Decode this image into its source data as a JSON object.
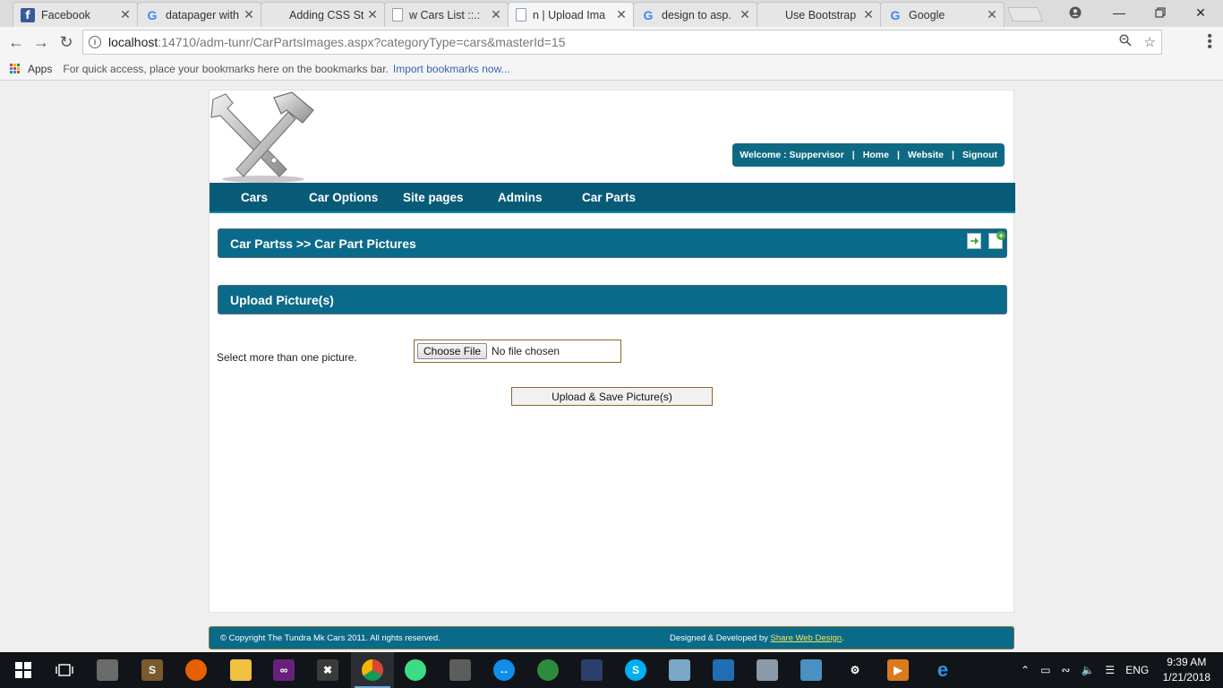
{
  "browser": {
    "tabs": [
      {
        "title": "Facebook",
        "favicon": "facebook-icon",
        "active": false
      },
      {
        "title": "datapager with",
        "favicon": "google-icon",
        "active": false
      },
      {
        "title": "Adding CSS St",
        "favicon": "microsoft-icon",
        "active": false
      },
      {
        "title": "w Cars List ::.:",
        "favicon": "page-icon",
        "active": false
      },
      {
        "title": "n | Upload Ima",
        "favicon": "page-icon",
        "active": true
      },
      {
        "title": "design to asp.",
        "favicon": "google-icon",
        "active": false
      },
      {
        "title": "Use Bootstrap",
        "favicon": "microsoft-icon",
        "active": false
      },
      {
        "title": "Google",
        "favicon": "google-icon",
        "active": false
      }
    ],
    "url_host": "localhost",
    "url_rest": ":14710/adm-tunr/CarPartsImages.aspx?categoryType=cars&masterId=15",
    "bookmarks": {
      "apps_label": "Apps",
      "hint": "For quick access, place your bookmarks here on the bookmarks bar.",
      "import_link": "Import bookmarks now..."
    }
  },
  "page": {
    "userbar": {
      "welcome": "Welcome : Suppervisor",
      "links": [
        "Home",
        "Website",
        "Signout"
      ]
    },
    "nav": [
      "Cars",
      "Car Options",
      "Site pages",
      "Admins",
      "Car Parts"
    ],
    "breadcrumb": "Car Partss >> Car Part Pictures",
    "upload_header": "Upload Picture(s)",
    "form": {
      "label": "Select more than one picture.",
      "choose_button": "Choose File",
      "file_status": "No file chosen",
      "submit": "Upload & Save Picture(s)"
    },
    "footer": {
      "copyright": "© Copyright The Tundra Mk Cars 2011. All rights reserved.",
      "designed_by": "Designed & Developed by",
      "designer_link": "Share Web Design",
      "designer_tail": "."
    }
  },
  "taskbar": {
    "language": "ENG",
    "time": "9:39 AM",
    "date": "1/21/2018"
  },
  "colors": {
    "theme_teal": "#0a6a89",
    "nav_teal": "#075b77",
    "footer_link": "#f2e85a"
  }
}
